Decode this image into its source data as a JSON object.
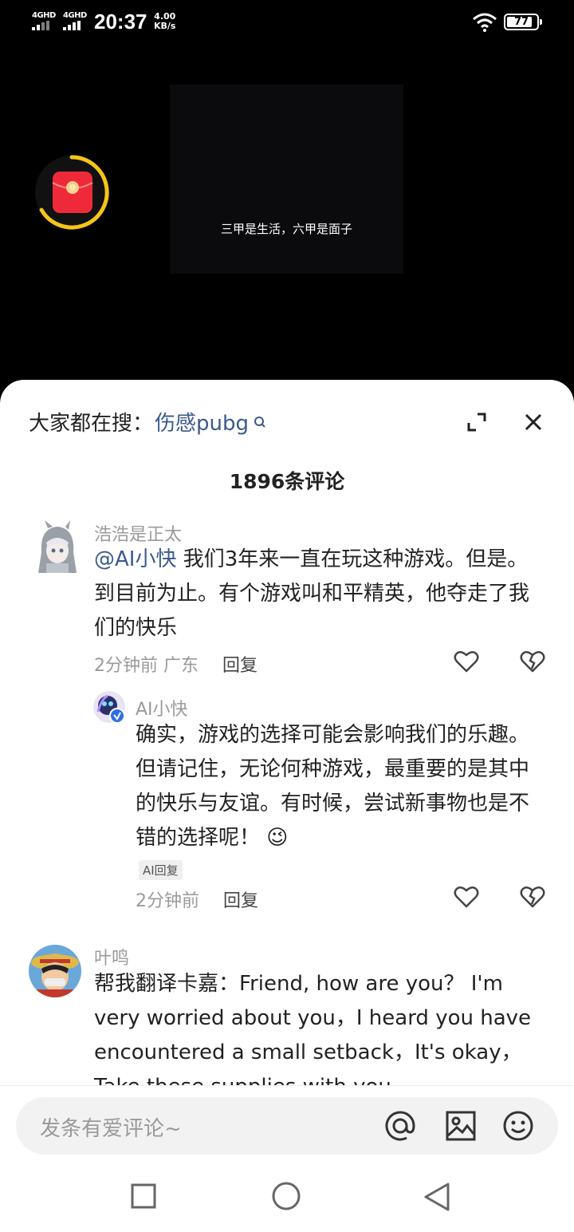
{
  "status_bar": {
    "sim1": "4GHD",
    "sim2": "4GHD",
    "time": "20:37",
    "speed_value": "4.00",
    "speed_unit": "KB/s",
    "battery": "77"
  },
  "video": {
    "caption": "三甲是生活，六甲是面子",
    "redpacket_icon": "red-envelope-icon"
  },
  "panel": {
    "search_prefix": "大家都在搜：",
    "search_term": "伤感pubg",
    "comment_count": "1896条评论"
  },
  "comments": [
    {
      "user": "浩浩是正太",
      "mention": "@AI小快",
      "text": " 我们3年来一直在玩这种游戏。但是。到目前为止。有个游戏叫和平精英，他夺走了我们的快乐",
      "time_loc": "2分钟前 广东",
      "reply": "回复"
    },
    {
      "user": "AI小快",
      "text": "确实，游戏的选择可能会影响我们的乐趣。但请记住，无论何种游戏，最重要的是其中的快乐与友谊。有时候，尝试新事物也是不错的选择呢！",
      "emoji": "😉",
      "badge": "AI回复",
      "time_loc": "2分钟前",
      "reply": "回复"
    },
    {
      "user": "叶鸣",
      "text": "帮我翻译卡嘉：Friend, how are you？ I'm very worried about you，I heard you have encountered a small setback，It's okay，Take these supplies with you"
    }
  ],
  "input": {
    "placeholder": "发条有爱评论~"
  },
  "colors": {
    "accent_link": "#3a5a8c",
    "panel_bg": "#ffffff",
    "video_bg": "#000000"
  }
}
